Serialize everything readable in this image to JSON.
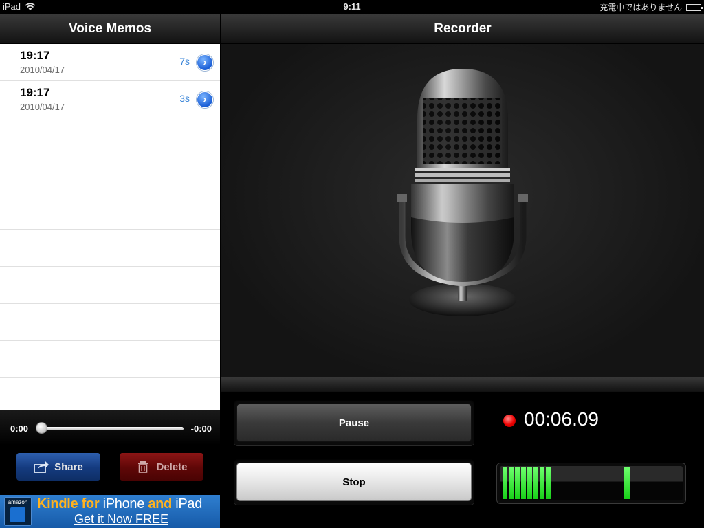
{
  "status": {
    "device": "iPad",
    "time": "9:11",
    "charging": "充電中ではありません"
  },
  "left": {
    "title": "Voice Memos",
    "memos": [
      {
        "time": "19:17",
        "date": "2010/04/17",
        "duration": "7s"
      },
      {
        "time": "19:17",
        "date": "2010/04/17",
        "duration": "3s"
      }
    ],
    "playback": {
      "elapsed": "0:00",
      "remaining": "-0:00",
      "position": 0
    },
    "share_label": "Share",
    "delete_label": "Delete",
    "ad": {
      "logo": "amazon",
      "line1_a": "Kindle for ",
      "line1_b": "iPhone",
      "line1_c": " and ",
      "line1_d": "iPad",
      "line2": "Get it Now FREE"
    }
  },
  "right": {
    "title": "Recorder",
    "pause_label": "Pause",
    "stop_label": "Stop",
    "elapsed": "00:06.09",
    "meter": {
      "level_segments": 8,
      "peak_fraction": 0.68,
      "color": "#22dd22"
    }
  },
  "colors": {
    "accent_blue": "#3a85d8",
    "record_red": "#e00000",
    "delete_red": "#6e0a0a",
    "share_blue": "#1c4a96"
  }
}
